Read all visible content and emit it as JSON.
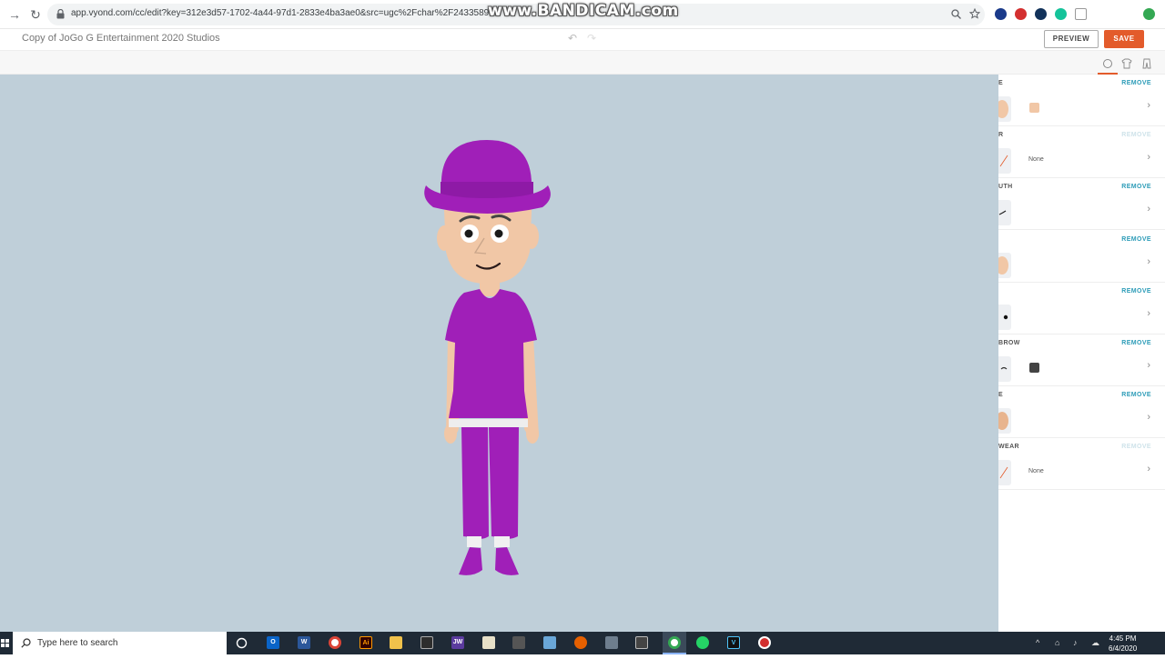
{
  "browser": {
    "url": "app.vyond.com/cc/edit?key=312e3d57-1702-4a44-97d1-2833e4ba3ae0&src=ugc%2Fchar%2F2433589",
    "watermark": "www.BANDICAM.com"
  },
  "header": {
    "doc_title": "Copy of JoGo G Entertainment 2020 Studios",
    "preview_label": "PREVIEW",
    "save_label": "SAVE"
  },
  "panel": {
    "rows": [
      {
        "label": "E",
        "remove": "REMOVE",
        "remove_active": true,
        "value": "",
        "swatch": "#f1c7a6",
        "thumb": "face"
      },
      {
        "label": "R",
        "remove": "REMOVE",
        "remove_active": false,
        "value": "None",
        "swatch": "",
        "thumb": "none-slash"
      },
      {
        "label": "UTH",
        "remove": "REMOVE",
        "remove_active": true,
        "value": "",
        "swatch": "",
        "thumb": "mouth"
      },
      {
        "label": "",
        "remove": "REMOVE",
        "remove_active": true,
        "value": "",
        "swatch": "",
        "thumb": "ear"
      },
      {
        "label": "",
        "remove": "REMOVE",
        "remove_active": true,
        "value": "",
        "swatch": "",
        "thumb": "eye"
      },
      {
        "label": "BROW",
        "remove": "REMOVE",
        "remove_active": true,
        "value": "",
        "swatch": "#444444",
        "thumb": "brow"
      },
      {
        "label": "E",
        "remove": "REMOVE",
        "remove_active": true,
        "value": "",
        "swatch": "",
        "thumb": "nose"
      },
      {
        "label": "WEAR",
        "remove": "REMOVE",
        "remove_active": false,
        "value": "None",
        "swatch": "",
        "thumb": "none-slash"
      }
    ],
    "remove_active_color": "#2d9cb8",
    "remove_inactive_color": "#cfe3ea"
  },
  "character": {
    "outfit_color": "#a01fb8",
    "skin_color": "#f1c7a6"
  },
  "taskbar": {
    "search_placeholder": "Type here to search",
    "time": "4:45 PM",
    "date": "6/4/2020"
  }
}
